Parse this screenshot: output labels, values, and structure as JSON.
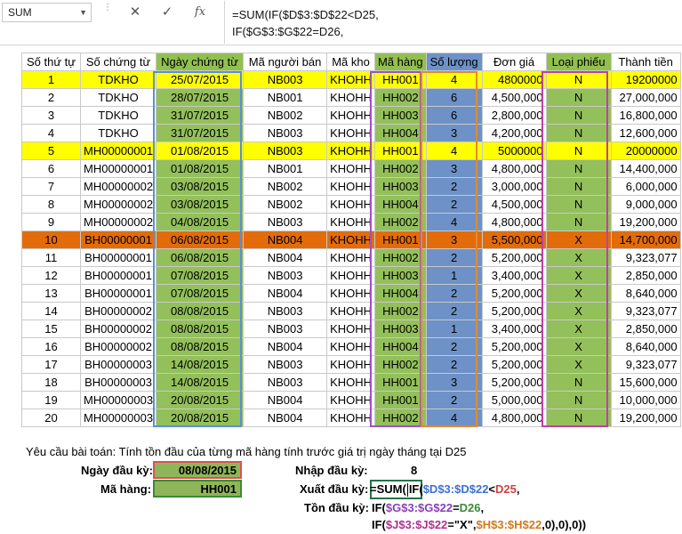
{
  "formula_bar": {
    "name_box": "SUM",
    "formula_line1": "=SUM(IF($D$3:$D$22<D25,",
    "formula_line2": "IF($G$3:$G$22=D26,"
  },
  "colors": {
    "header_green": "#92c050",
    "header_blue": "#6e92c7",
    "row_yellow": "#ffff00",
    "row_orange": "#e36c0a",
    "active_border": "#217346"
  },
  "table": {
    "headers": [
      "Số thứ tự",
      "Số chứng từ",
      "Ngày chứng từ",
      "Mã người bán",
      "Mã kho",
      "Mã hàng",
      "Số lượng",
      "Đơn giá",
      "Loại phiếu",
      "Thành tiền"
    ],
    "rows": [
      [
        "1",
        "TDKHO",
        "25/07/2015",
        "NB003",
        "KHOHH",
        "HH001",
        "4",
        "4800000",
        "N",
        "19200000"
      ],
      [
        "2",
        "TDKHO",
        "28/07/2015",
        "NB001",
        "KHOHH",
        "HH002",
        "6",
        "4,500,000",
        "N",
        "27,000,000"
      ],
      [
        "3",
        "TDKHO",
        "31/07/2015",
        "NB002",
        "KHOHH",
        "HH003",
        "6",
        "2,800,000",
        "N",
        "16,800,000"
      ],
      [
        "4",
        "TDKHO",
        "31/07/2015",
        "NB003",
        "KHOHH",
        "HH004",
        "3",
        "4,200,000",
        "N",
        "12,600,000"
      ],
      [
        "5",
        "MH00000001",
        "01/08/2015",
        "NB003",
        "KHOHH",
        "HH001",
        "4",
        "5000000",
        "N",
        "20000000"
      ],
      [
        "6",
        "MH00000001",
        "01/08/2015",
        "NB001",
        "KHOHH",
        "HH002",
        "3",
        "4,800,000",
        "N",
        "14,400,000"
      ],
      [
        "7",
        "MH00000002",
        "03/08/2015",
        "NB002",
        "KHOHH",
        "HH003",
        "2",
        "3,000,000",
        "N",
        "6,000,000"
      ],
      [
        "8",
        "MH00000002",
        "03/08/2015",
        "NB002",
        "KHOHH",
        "HH004",
        "2",
        "4,500,000",
        "N",
        "9,000,000"
      ],
      [
        "9",
        "MH00000002",
        "04/08/2015",
        "NB003",
        "KHOHH",
        "HH002",
        "4",
        "4,800,000",
        "N",
        "19,200,000"
      ],
      [
        "10",
        "BH00000001",
        "06/08/2015",
        "NB004",
        "KHOHH",
        "HH001",
        "3",
        "5,500,000",
        "X",
        "14,700,000"
      ],
      [
        "11",
        "BH00000001",
        "06/08/2015",
        "NB004",
        "KHOHH",
        "HH002",
        "2",
        "5,200,000",
        "X",
        "9,323,077"
      ],
      [
        "12",
        "BH00000001",
        "07/08/2015",
        "NB003",
        "KHOHH",
        "HH003",
        "1",
        "3,400,000",
        "X",
        "2,850,000"
      ],
      [
        "13",
        "BH00000001",
        "07/08/2015",
        "NB004",
        "KHOHH",
        "HH004",
        "2",
        "5,200,000",
        "X",
        "8,640,000"
      ],
      [
        "14",
        "BH00000002",
        "08/08/2015",
        "NB003",
        "KHOHH",
        "HH002",
        "2",
        "5,200,000",
        "X",
        "9,323,077"
      ],
      [
        "15",
        "BH00000002",
        "08/08/2015",
        "NB003",
        "KHOHH",
        "HH003",
        "1",
        "3,400,000",
        "X",
        "2,850,000"
      ],
      [
        "16",
        "BH00000002",
        "08/08/2015",
        "NB004",
        "KHOHH",
        "HH004",
        "2",
        "5,200,000",
        "X",
        "8,640,000"
      ],
      [
        "17",
        "BH00000003",
        "14/08/2015",
        "NB003",
        "KHOHH",
        "HH002",
        "2",
        "5,200,000",
        "X",
        "9,323,077"
      ],
      [
        "18",
        "BH00000003",
        "14/08/2015",
        "NB003",
        "KHOHH",
        "HH001",
        "3",
        "5,200,000",
        "N",
        "15,600,000"
      ],
      [
        "19",
        "MH00000003",
        "20/08/2015",
        "NB004",
        "KHOHH",
        "HH001",
        "2",
        "5,000,000",
        "N",
        "10,000,000"
      ],
      [
        "20",
        "MH00000003",
        "20/08/2015",
        "NB004",
        "KHOHH",
        "HH002",
        "4",
        "4,800,000",
        "N",
        "19,200,000"
      ]
    ]
  },
  "task": {
    "requirement": "Yêu cầu bài toán: Tính tồn đầu của từng mã hàng tính trước giá trị ngày tháng tại D25",
    "start_date_label": "Ngày đầu kỳ:",
    "start_date_value": "08/08/2015",
    "item_label": "Mã hàng:",
    "item_value": "HH001",
    "in_label": "Nhập đầu kỳ:",
    "in_value": "8",
    "out_label": "Xuất đầu kỳ:",
    "stock_label": "Tồn đầu kỳ:"
  },
  "edit_formula": {
    "l1_sum": "=SUM(",
    "l1_if": "IF(",
    "l1_range": "$D$3:$D$22",
    "l1_op": "<",
    "l1_ref": "D25",
    "l1_end": ",",
    "l2_if": "IF(",
    "l2_range": "$G$3:$G$22",
    "l2_op": "=",
    "l2_ref": "D26",
    "l2_end": ",",
    "l3_if": "IF(",
    "l3_range": "$J$3:$J$22",
    "l3_op": "=\"X\",",
    "l3_range2": "$H$3:$H$22",
    "l3_end": ",0),0),0))"
  }
}
